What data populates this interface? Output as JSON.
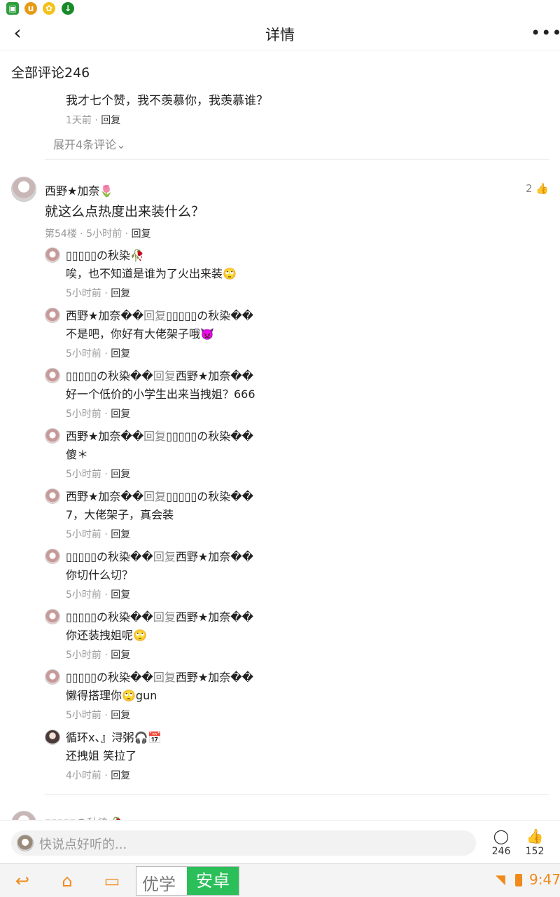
{
  "status_bar": {
    "icons": [
      "image-icon",
      "u-icon",
      "bee-icon",
      "download-icon"
    ]
  },
  "header": {
    "title": "详情",
    "back_icon": "chevron-left-icon",
    "more_icon": "more-dots-icon"
  },
  "comments_section": {
    "title": "全部评论246"
  },
  "previous_thread": {
    "reply_text": "我才七个赞，我不羡慕你，我羡慕谁？",
    "time": "1天前",
    "separator": " · ",
    "reply_label": "回复",
    "expand_label": "展开4条评论"
  },
  "main_comment": {
    "author": "西野★加奈🌷",
    "text": "就这么点热度出来装什么？",
    "floor": "第54楼",
    "time": "5小时前",
    "separator": " · ",
    "reply_label": "回复",
    "like_count": "2"
  },
  "replies": [
    {
      "author": "▯▯▯▯▯の秋染🥀",
      "reply_word": "",
      "target": "",
      "text": "唉，也不知道是谁为了火出来装🙄",
      "time": "5小时前",
      "reply_label": "回复"
    },
    {
      "author": "西野★加奈��",
      "reply_word": "回复",
      "target": "▯▯▯▯▯の秋染��",
      "text": "不是吧，你好有大佬架子哦👿",
      "time": "5小时前",
      "reply_label": "回复"
    },
    {
      "author": "▯▯▯▯▯の秋染��",
      "reply_word": "回复",
      "target": "西野★加奈��",
      "text": "好一个低价的小学生出来当拽姐？666",
      "time": "5小时前",
      "reply_label": "回复"
    },
    {
      "author": "西野★加奈��",
      "reply_word": "回复",
      "target": "▯▯▯▯▯の秋染��",
      "text": "傻＊",
      "time": "5小时前",
      "reply_label": "回复"
    },
    {
      "author": "西野★加奈��",
      "reply_word": "回复",
      "target": "▯▯▯▯▯の秋染��",
      "text": "7，大佬架子，真会装",
      "time": "5小时前",
      "reply_label": "回复"
    },
    {
      "author": "▯▯▯▯▯の秋染��",
      "reply_word": "回复",
      "target": "西野★加奈��",
      "text": "你切什么切？",
      "time": "5小时前",
      "reply_label": "回复"
    },
    {
      "author": "▯▯▯▯▯の秋染��",
      "reply_word": "回复",
      "target": "西野★加奈��",
      "text": "你还装拽姐呢🙄",
      "time": "5小时前",
      "reply_label": "回复"
    },
    {
      "author": "▯▯▯▯▯の秋染��",
      "reply_word": "回复",
      "target": "西野★加奈��",
      "text": "懒得搭理你🙄gun",
      "time": "5小时前",
      "reply_label": "回复"
    },
    {
      "author": "循环x、』浔粥🎧📅",
      "reply_word": "",
      "target": "",
      "text": "还拽姐 笑拉了",
      "time": "4小时前",
      "reply_label": "回复"
    }
  ],
  "next_comment": {
    "author": "▯▯▯▯▯の秋染🥀"
  },
  "input_bar": {
    "placeholder": "快说点好听的...",
    "comment_count": "246",
    "like_count": "152"
  },
  "nav_bar": {
    "ime_label_1": "优学",
    "ime_label_2": "安卓",
    "time": "9:47"
  },
  "colors": {
    "accent_orange": "#f08a1a",
    "ime_green": "#2bbf5a",
    "muted_text": "#999999"
  }
}
